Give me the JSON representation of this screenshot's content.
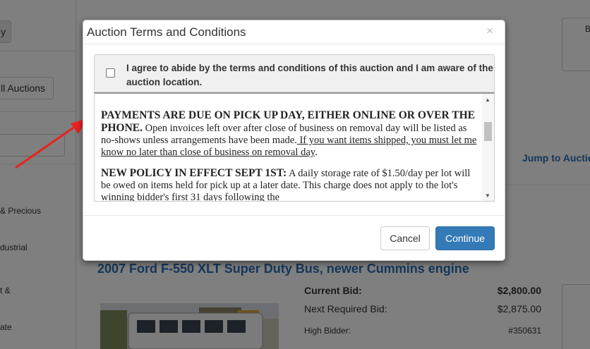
{
  "background": {
    "sidebar": {
      "top_button_label": "y",
      "all_auctions_label": "ll Auctions",
      "categories": [
        "& Precious",
        "dustrial",
        "t &",
        "ate"
      ]
    },
    "jump_link": "Jump to Auctio",
    "right_card_label": "B",
    "lot": {
      "title": "2007 Ford F-550 XLT Super Duty Bus, newer Cummins engine",
      "current_bid_label": "Current Bid:",
      "current_bid_value": "$2,800.00",
      "next_bid_label": "Next Required Bid:",
      "next_bid_value": "$2,875.00",
      "high_bidder_label": "High Bidder:",
      "high_bidder_value": "#350631"
    }
  },
  "modal": {
    "title": "Auction Terms and Conditions",
    "close_symbol": "×",
    "agree_text": "I agree to abide by the terms and conditions of this auction and I am aware of the auction location.",
    "terms": {
      "p1_bold": "PAYMENTS ARE DUE ON PICK UP DAY, EITHER ONLINE OR OVER THE PHONE.",
      "p1_text": " Open invoices left over after close of business on removal day will be listed as no-shows unless arrangements have been made.",
      "p1_underline": " If you want items shipped, you must let me know no later than close of business on removal day",
      "p1_end": ".",
      "p2_bold": "NEW POLICY IN EFFECT SEPT 1ST:",
      "p2_text": " A daily storage rate of $1.50/day per lot will be owed on items held for pick up at a later date. This charge does not apply to the lot's winning bidder's first 31 days following the"
    },
    "cancel_label": "Cancel",
    "continue_label": "Continue"
  },
  "colors": {
    "primary": "#337ab7",
    "link": "#2a6fb5",
    "arrow": "#e8231f"
  }
}
